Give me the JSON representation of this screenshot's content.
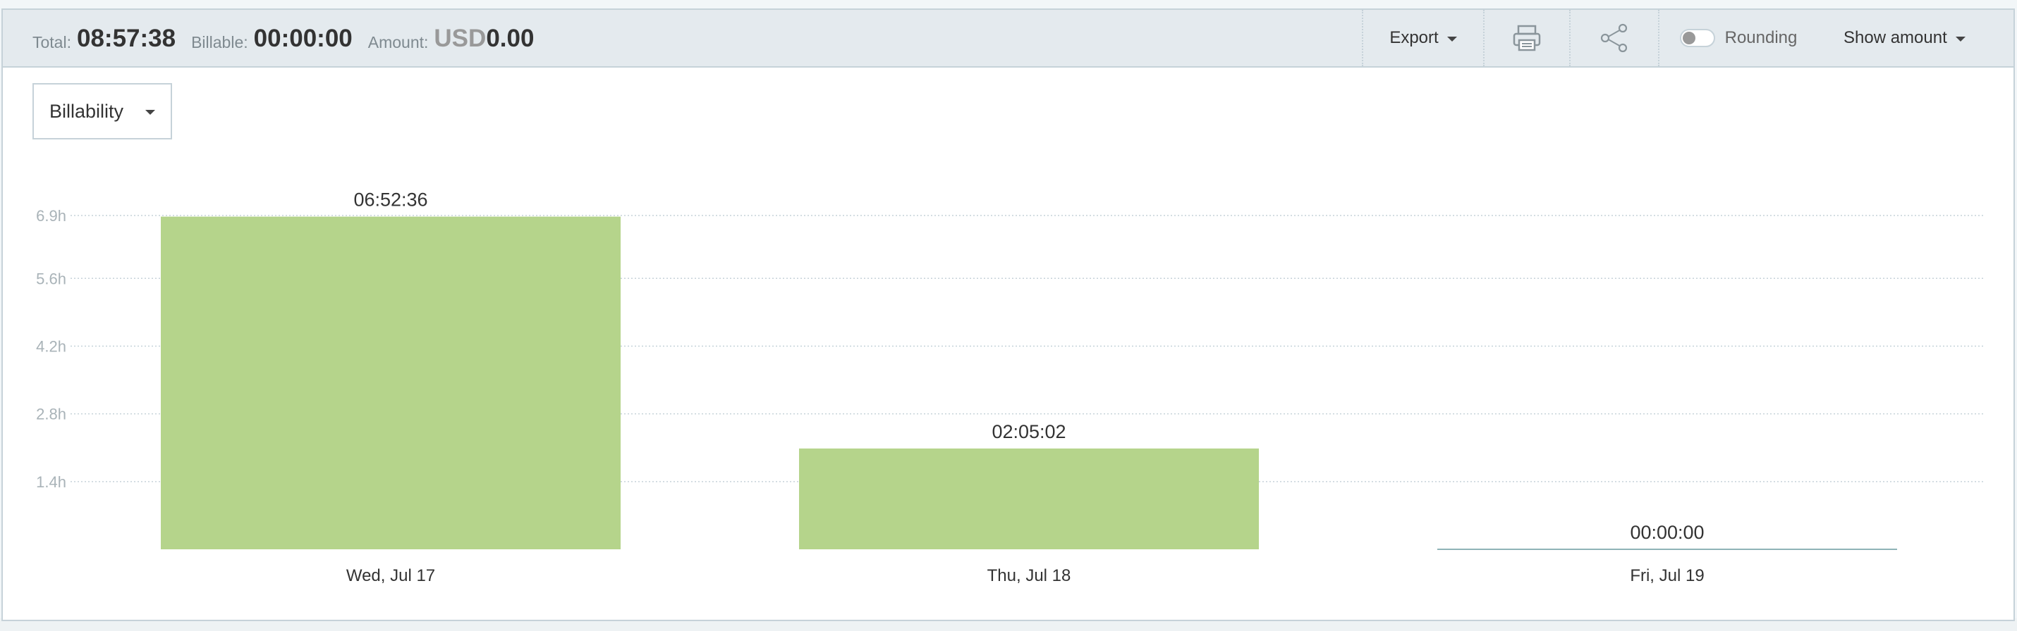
{
  "summary": {
    "total_label": "Total:",
    "total_value": "08:57:38",
    "billable_label": "Billable:",
    "billable_value": "00:00:00",
    "amount_label": "Amount:",
    "amount_currency": "USD",
    "amount_value": "0.00"
  },
  "toolbar": {
    "export_label": "Export",
    "print_icon": "printer-icon",
    "share_icon": "share-icon",
    "rounding_label": "Rounding",
    "rounding_on": false,
    "show_amount_label": "Show amount"
  },
  "filter": {
    "selected": "Billability"
  },
  "colors": {
    "bar": "#b5d48b",
    "zero_bar": "#8fb3b7",
    "grid": "#c6d2d9"
  },
  "chart_data": {
    "type": "bar",
    "categories": [
      "Wed, Jul 17",
      "Thu, Jul 18",
      "Fri, Jul 19"
    ],
    "values": [
      6.8767,
      2.0839,
      0
    ],
    "data_labels": [
      "06:52:36",
      "02:05:02",
      "00:00:00"
    ],
    "y_ticks": [
      1.4,
      2.8,
      4.2,
      5.6,
      6.9
    ],
    "y_tick_labels": [
      "1.4h",
      "2.8h",
      "4.2h",
      "5.6h",
      "6.9h"
    ],
    "grid": true
  }
}
